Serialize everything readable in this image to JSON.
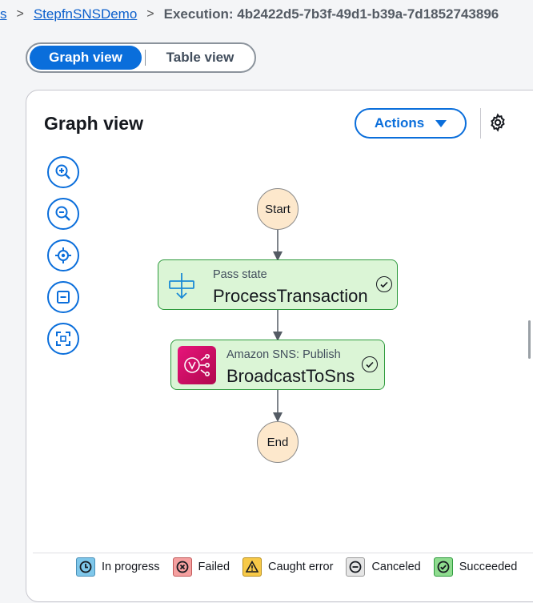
{
  "breadcrumb": {
    "partial": "s",
    "parent": "StepfnSNSDemo",
    "current": "Execution: 4b2422d5-7b3f-49d1-b39a-7d1852743896"
  },
  "view_toggle": {
    "active": "Graph view",
    "inactive": "Table view"
  },
  "panel": {
    "title": "Graph view",
    "actions_label": "Actions"
  },
  "toolbar": [
    "zoom-in",
    "zoom-out",
    "center",
    "fit",
    "fullscreen"
  ],
  "graph": {
    "start": "Start",
    "end": "End",
    "states": [
      {
        "type": "Pass state",
        "name": "ProcessTransaction",
        "status": "succeeded"
      },
      {
        "type": "Amazon SNS: Publish",
        "name": "BroadcastToSns",
        "status": "succeeded"
      }
    ]
  },
  "legend": [
    {
      "label": "In progress",
      "color": "#7fc7ea"
    },
    {
      "label": "Failed",
      "color": "#f5a0a0"
    },
    {
      "label": "Caught error",
      "color": "#f7c948"
    },
    {
      "label": "Canceled",
      "color": "#e5e5e5"
    },
    {
      "label": "Succeeded",
      "color": "#8fdc8f"
    }
  ],
  "colors": {
    "accent": "#0a6edb",
    "success_bg": "#dbf5d6",
    "success_border": "#2e9a3d",
    "terminal_bg": "#fde8cc"
  }
}
